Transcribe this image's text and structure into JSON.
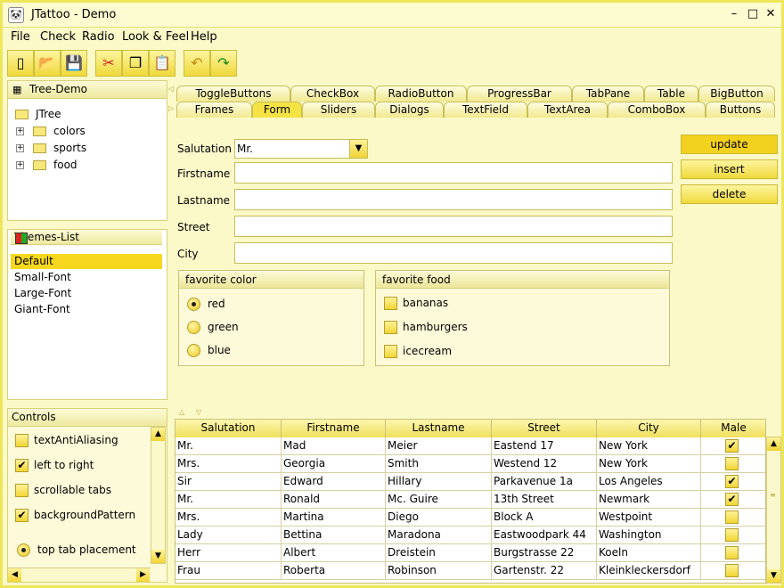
{
  "window": {
    "title": "JTattoo - Demo",
    "icon": "panda-icon",
    "min": "–",
    "max": "□",
    "close": "✕"
  },
  "menu": [
    "File",
    "Check",
    "Radio",
    "Look & Feel",
    "Help"
  ],
  "toolbar": [
    {
      "icon": "new-file-icon",
      "glyph": "▯"
    },
    {
      "icon": "open-folder-icon",
      "glyph": "📂"
    },
    {
      "icon": "save-icon",
      "glyph": "💾"
    },
    {
      "icon": "cut-icon",
      "glyph": "✂"
    },
    {
      "icon": "copy-icon",
      "glyph": "❐"
    },
    {
      "icon": "paste-icon",
      "glyph": "📋",
      "disabled": true
    },
    {
      "icon": "undo-icon",
      "glyph": "↶"
    },
    {
      "icon": "redo-icon",
      "glyph": "↷"
    }
  ],
  "tree": {
    "title": "Tree-Demo",
    "root": "JTree",
    "nodes": [
      "colors",
      "sports",
      "food"
    ]
  },
  "themes": {
    "title": "Themes-List",
    "items": [
      "Default",
      "Small-Font",
      "Large-Font",
      "Giant-Font"
    ],
    "selected": "Default"
  },
  "controls": {
    "title": "Controls",
    "items": [
      {
        "label": "textAntiAliasing",
        "checked": false
      },
      {
        "label": "left to right",
        "checked": true
      },
      {
        "label": "scrollable tabs",
        "checked": false
      },
      {
        "label": "backgroundPattern",
        "checked": true
      }
    ],
    "radio": "top tab placement"
  },
  "tabs": {
    "row1": [
      "ToggleButtons",
      "CheckBox",
      "RadioButton",
      "ProgressBar",
      "TabPane",
      "Table",
      "BigButton"
    ],
    "row2": [
      "Frames",
      "Form",
      "Sliders",
      "Dialogs",
      "TextField",
      "TextArea",
      "ComboBox",
      "Buttons"
    ],
    "active": "Form"
  },
  "form": {
    "salutation_label": "Salutation",
    "salutation_value": "Mr.",
    "firstname_label": "Firstname",
    "lastname_label": "Lastname",
    "street_label": "Street",
    "city_label": "City"
  },
  "buttons": {
    "update": "update",
    "insert": "insert",
    "delete": "delete"
  },
  "color_group": {
    "title": "favorite color",
    "items": [
      "red",
      "green",
      "blue"
    ],
    "selected": "red"
  },
  "food_group": {
    "title": "favorite food",
    "items": [
      "bananas",
      "hamburgers",
      "icecream"
    ]
  },
  "table": {
    "columns": [
      "Salutation",
      "Firstname",
      "Lastname",
      "Street",
      "City",
      "Male"
    ],
    "rows": [
      [
        "Mr.",
        "Mad",
        "Meier",
        "Eastend 17",
        "New York",
        true
      ],
      [
        "Mrs.",
        "Georgia",
        "Smith",
        "Westend 12",
        "New York",
        false
      ],
      [
        "Sir",
        "Edward",
        "Hillary",
        "Parkavenue 1a",
        "Los Angeles",
        true
      ],
      [
        "Mr.",
        "Ronald",
        "Mc. Guire",
        "13th Street",
        "Newmark",
        true
      ],
      [
        "Mrs.",
        "Martina",
        "Diego",
        "Block A",
        "Westpoint",
        false
      ],
      [
        "Lady",
        "Bettina",
        "Maradona",
        "Eastwoodpark 44",
        "Washington",
        false
      ],
      [
        "Herr",
        "Albert",
        "Dreistein",
        "Burgstrasse 22",
        "Koeln",
        false
      ],
      [
        "Frau",
        "Roberta",
        "Robinson",
        "Gartenstr. 22",
        "Kleinkleckersdorf",
        false
      ]
    ]
  }
}
